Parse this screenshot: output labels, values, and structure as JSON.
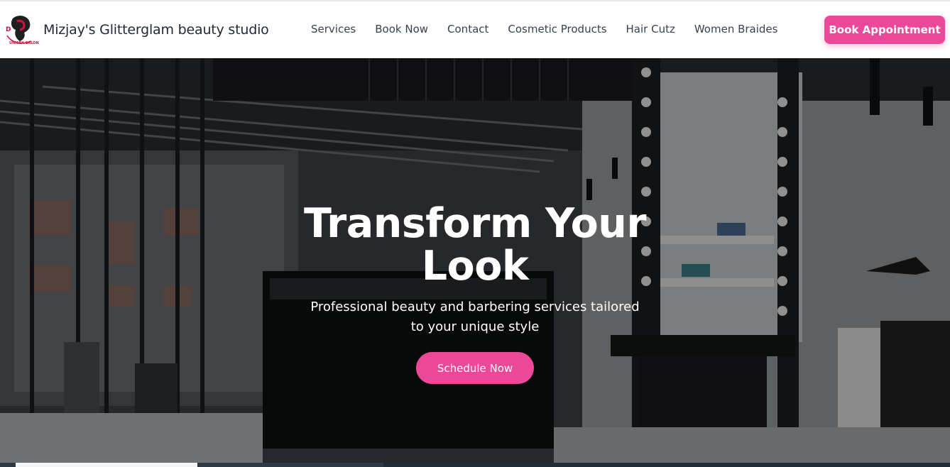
{
  "brand": {
    "name": "Mizjay's Glitterglam beauty studio",
    "logo_text": "UNISEX SALON",
    "logo_icon": "salon-face-logo"
  },
  "nav": {
    "links": [
      "Services",
      "Book Now",
      "Contact",
      "Cosmetic Products",
      "Hair Cutz",
      "Women Braides"
    ],
    "cta_label": "Book Appointment"
  },
  "hero": {
    "title": "Transform Your Look",
    "subtitle": "Professional beauty and barbering services tailored to your unique style",
    "button_label": "Schedule Now"
  },
  "colors": {
    "accent": "#ec4899",
    "nav_text": "#374151",
    "brand_text": "#1f2937"
  }
}
